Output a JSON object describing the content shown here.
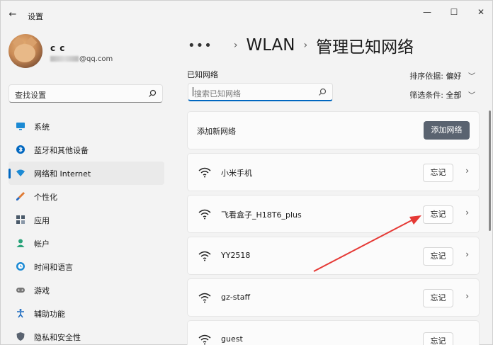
{
  "window": {
    "title": "设置",
    "back_icon": "arrow-left-icon",
    "controls": [
      "minimize-icon",
      "maximize-icon",
      "close-icon"
    ]
  },
  "profile": {
    "name": "c c",
    "email_visible": "@qq.com"
  },
  "sidebar": {
    "search_text": "查找设置",
    "items": [
      {
        "label": "系统",
        "icon": "monitor-icon",
        "color": "#0067c0"
      },
      {
        "label": "蓝牙和其他设备",
        "icon": "bluetooth-icon",
        "color": "#0067c0"
      },
      {
        "label": "网络和 Internet",
        "icon": "wifi-diamond-icon",
        "color": "#1b8ad4",
        "active": true
      },
      {
        "label": "个性化",
        "icon": "brush-icon",
        "color": "#e07a33"
      },
      {
        "label": "应用",
        "icon": "apps-icon",
        "color": "#4a5a6a"
      },
      {
        "label": "帐户",
        "icon": "person-icon",
        "color": "#2aa37a"
      },
      {
        "label": "时间和语言",
        "icon": "clock-globe-icon",
        "color": "#1b8ad4"
      },
      {
        "label": "游戏",
        "icon": "gamepad-icon",
        "color": "#666666"
      },
      {
        "label": "辅助功能",
        "icon": "accessibility-icon",
        "color": "#1b6ac0"
      },
      {
        "label": "隐私和安全性",
        "icon": "shield-icon",
        "color": "#5a6370"
      }
    ]
  },
  "header": {
    "breadcrumb_root": "WLAN",
    "breadcrumb_current": "管理已知网络"
  },
  "known": {
    "label": "已知网络",
    "search_placeholder": "搜索已知网络",
    "sort_label": "排序依据:",
    "sort_value": "偏好",
    "filter_label": "筛选条件:",
    "filter_value": "全部"
  },
  "add_network": {
    "label": "添加新网络",
    "button": "添加网络"
  },
  "networks": [
    {
      "name": "小米手机",
      "forget": "忘记"
    },
    {
      "name": "飞看盒子_H18T6_plus",
      "forget": "忘记"
    },
    {
      "name": "YY2518",
      "forget": "忘记"
    },
    {
      "name": "gz-staff",
      "forget": "忘记"
    },
    {
      "name": "guest",
      "forget": "忘记"
    }
  ],
  "colors": {
    "accent": "#0067c0",
    "annotation_arrow": "#e53935",
    "add_button": "#5a6370"
  }
}
